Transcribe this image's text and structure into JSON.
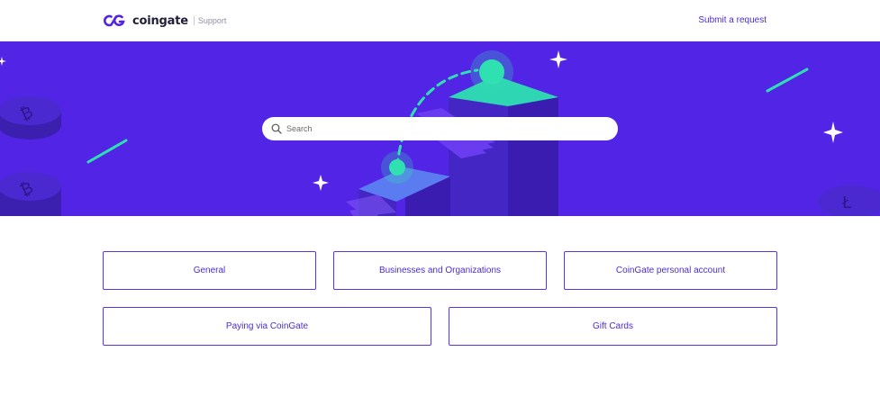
{
  "header": {
    "brand": "coingate",
    "section": "Support",
    "submit_label": "Submit a request",
    "logo_icon": "coingate-logo-icon"
  },
  "hero": {
    "search": {
      "placeholder": "Search",
      "value": "",
      "icon": "search-icon"
    },
    "colors": {
      "background": "#5224e6",
      "accent": "#2fe0b0"
    }
  },
  "categories": {
    "row1": [
      {
        "label": "General"
      },
      {
        "label": "Businesses and Organizations"
      },
      {
        "label": "CoinGate personal account"
      }
    ],
    "row2": [
      {
        "label": "Paying via CoinGate"
      },
      {
        "label": "Gift Cards"
      }
    ]
  },
  "colors": {
    "brand": "#4b2bd6",
    "border": "#5a36d9"
  }
}
